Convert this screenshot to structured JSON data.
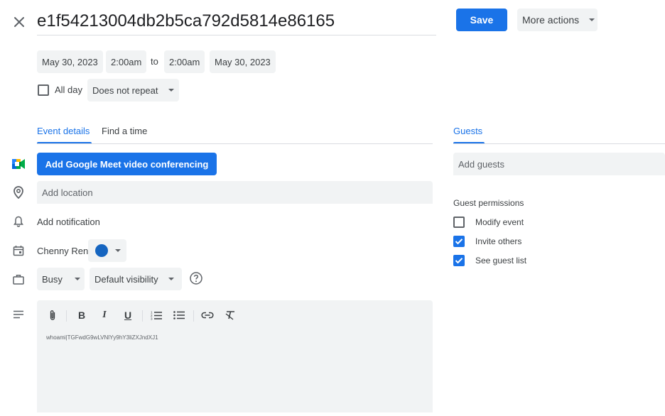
{
  "header": {
    "title": "e1f54213004db2b5ca792d5814e86165",
    "save_label": "Save",
    "more_actions_label": "More actions"
  },
  "datetime": {
    "start_date": "May 30, 2023",
    "start_time": "2:00am",
    "to_label": "to",
    "end_time": "2:00am",
    "end_date": "May 30, 2023"
  },
  "options": {
    "all_day_label": "All day",
    "all_day_checked": false,
    "repeat_label": "Does not repeat"
  },
  "tabs": {
    "event_details": "Event details",
    "find_a_time": "Find a time",
    "guests": "Guests"
  },
  "details": {
    "meet_button_label": "Add Google Meet video conferencing",
    "location_placeholder": "Add location",
    "notification_label": "Add notification",
    "calendar_owner": "Chenny Ren",
    "event_color": "#1565c0",
    "availability_label": "Busy",
    "visibility_label": "Default visibility",
    "description_text": "whoami|TGFwdG9wLVNlYy9hY3liZXJndXJ1"
  },
  "toolbar": {
    "icons": [
      "attachment-icon",
      "bold-icon",
      "italic-icon",
      "underline-icon",
      "numbered-list-icon",
      "bulleted-list-icon",
      "link-icon",
      "clear-formatting-icon"
    ],
    "bold_glyph": "B",
    "italic_glyph": "I",
    "underline_glyph": "U"
  },
  "guests": {
    "add_guests_placeholder": "Add guests",
    "permissions_title": "Guest permissions",
    "permissions": [
      {
        "label": "Modify event",
        "checked": false
      },
      {
        "label": "Invite others",
        "checked": true
      },
      {
        "label": "See guest list",
        "checked": true
      }
    ]
  },
  "colors": {
    "accent": "#1a73e8",
    "field_background": "#f1f3f4"
  }
}
